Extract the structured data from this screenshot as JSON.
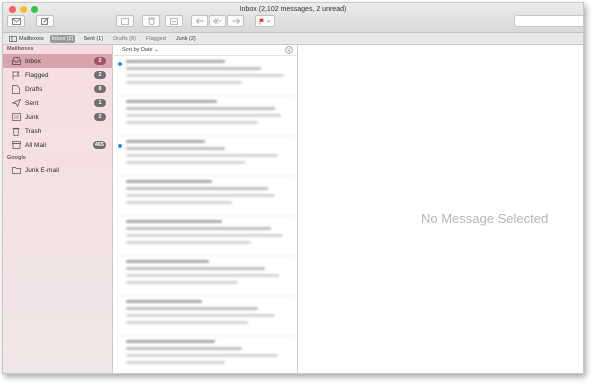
{
  "window": {
    "title": "Inbox (2,102 messages, 2 unread)"
  },
  "favorites": [
    {
      "label": "Mailboxes",
      "selected": false
    },
    {
      "label": "Inbox (2)",
      "selected": true
    },
    {
      "label": "Sent (1)",
      "selected": false
    },
    {
      "label": "Drafts (8)",
      "selected": false
    },
    {
      "label": "Flagged",
      "selected": false
    },
    {
      "label": "Junk (2)",
      "selected": false
    }
  ],
  "sidebar": {
    "section_mailboxes": "Mailboxes",
    "items": [
      {
        "label": "Inbox",
        "badge": "2",
        "icon": "inbox-icon"
      },
      {
        "label": "Flagged",
        "badge": "2",
        "icon": "flag-icon"
      },
      {
        "label": "Drafts",
        "badge": "8",
        "icon": "drafts-icon"
      },
      {
        "label": "Sent",
        "badge": "1",
        "icon": "sent-icon"
      },
      {
        "label": "Junk",
        "badge": "2",
        "icon": "junk-icon"
      },
      {
        "label": "Trash",
        "badge": "",
        "icon": "trash-icon"
      },
      {
        "label": "All Mail",
        "badge": "465",
        "icon": "archive-icon"
      }
    ],
    "section_google": "Google",
    "google_items": [
      {
        "label": "Junk E-mail",
        "icon": "junk-folder-icon"
      }
    ]
  },
  "list": {
    "sort_label": "Sort by Date ⌄"
  },
  "detail": {
    "empty_text": "No Message Selected"
  },
  "colors": {
    "accent": "#d9a3ad",
    "badge": "#6f6f6f",
    "unread": "#2d8be9"
  }
}
